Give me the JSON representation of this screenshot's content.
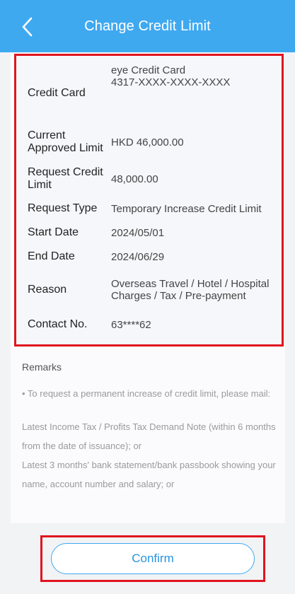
{
  "header": {
    "title": "Change Credit Limit"
  },
  "details": {
    "credit_card_label": "Credit Card",
    "credit_card_name": "eye Credit Card",
    "credit_card_number": "4317-XXXX-XXXX-XXXX",
    "approved_limit_label": "Current Approved Limit",
    "approved_limit_value": "HKD 46,000.00",
    "request_limit_label": "Request Credit Limit",
    "request_limit_value": "48,000.00",
    "request_type_label": "Request Type",
    "request_type_value": "Temporary Increase Credit Limit",
    "start_date_label": "Start Date",
    "start_date_value": "2024/05/01",
    "end_date_label": "End Date",
    "end_date_value": "2024/06/29",
    "reason_label": "Reason",
    "reason_value": "Overseas Travel / Hotel / Hospital Charges / Tax / Pre-payment",
    "contact_label": "Contact No.",
    "contact_value": "63****62"
  },
  "remarks": {
    "title": "Remarks",
    "line1": "• To request a permanent increase of credit limit, please mail:",
    "line2": "Latest Income Tax / Profits Tax Demand Note (within 6 months from the date of issuance); or",
    "line3": "Latest 3 months' bank statement/bank passbook showing your name, account number and salary; or"
  },
  "footer": {
    "confirm_label": "Confirm"
  }
}
